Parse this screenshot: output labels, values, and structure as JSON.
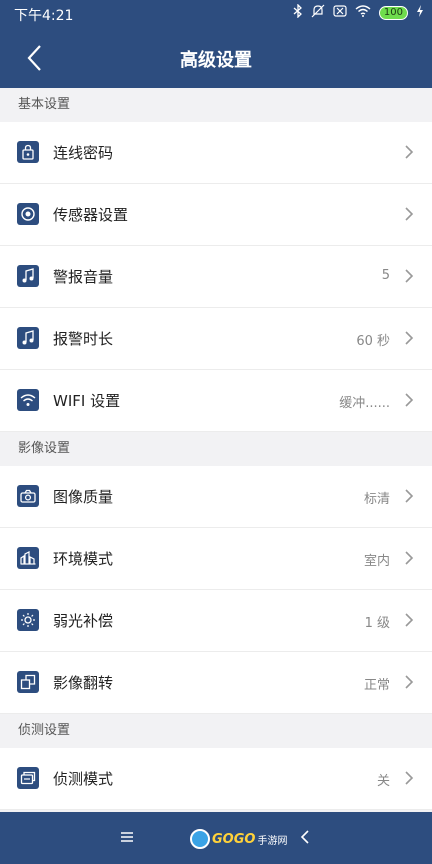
{
  "status": {
    "time": "下午4:21",
    "battery": "100"
  },
  "header": {
    "title": "高级设置"
  },
  "sections": [
    {
      "title": "基本设置",
      "rows": [
        {
          "label": "连线密码",
          "value": "",
          "icon": "lock-icon"
        },
        {
          "label": "传感器设置",
          "value": "",
          "icon": "sensor-icon"
        },
        {
          "label": "警报音量",
          "value": "5",
          "icon": "music-note-icon"
        },
        {
          "label": "报警时长",
          "value": "60 秒",
          "icon": "music-note-icon"
        },
        {
          "label": "WIFI 设置",
          "value": "缓冲......",
          "icon": "wifi-icon"
        }
      ]
    },
    {
      "title": "影像设置",
      "rows": [
        {
          "label": "图像质量",
          "value": "标清",
          "icon": "camera-icon"
        },
        {
          "label": "环境模式",
          "value": "室内",
          "icon": "environment-icon"
        },
        {
          "label": "弱光补偿",
          "value": "1 级",
          "icon": "brightness-icon"
        },
        {
          "label": "影像翻转",
          "value": "正常",
          "icon": "flip-icon"
        }
      ]
    },
    {
      "title": "侦测设置",
      "rows": [
        {
          "label": "侦测模式",
          "value": "关",
          "icon": "detection-icon"
        }
      ]
    }
  ],
  "bottom": {
    "logo_main": "GOGO",
    "logo_sub": "手游网"
  },
  "colors": {
    "primary": "#2d4d7f",
    "background": "#f2f2f4"
  }
}
